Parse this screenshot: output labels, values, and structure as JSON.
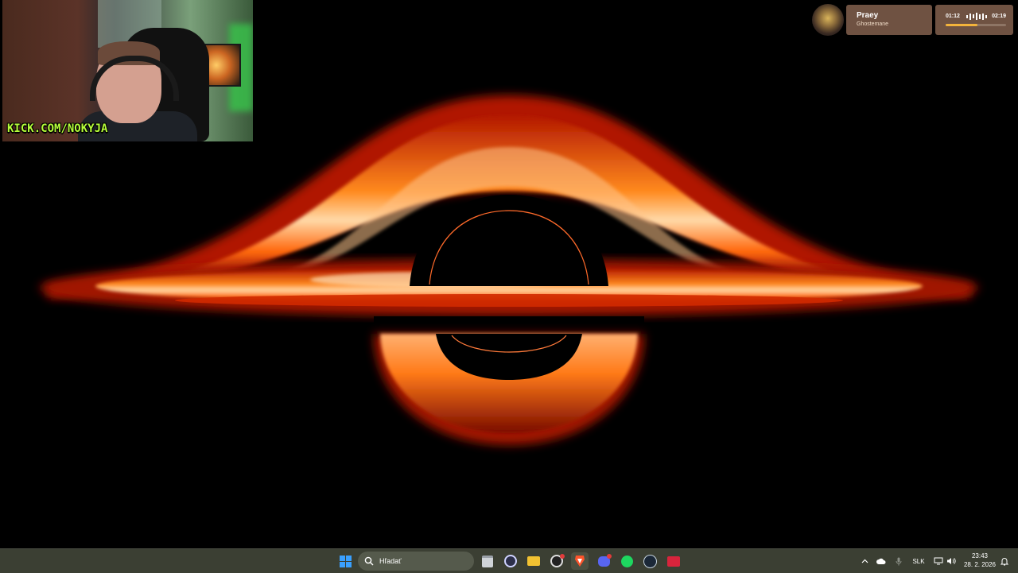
{
  "webcam": {
    "overlay_text": "KICK.COM/NOKYJA"
  },
  "now_playing": {
    "title": "Praey",
    "artist": "Ghostemane",
    "current_time": "01:12",
    "duration": "02:19",
    "progress": 0.52,
    "accent_color": "#f3b33b"
  },
  "taskbar": {
    "search_placeholder": "Hľadať",
    "apps": [
      "start-icon",
      "file-explorer-icon",
      "obs-icon",
      "folder-icon",
      "browser-icon",
      "brave-icon",
      "discord-icon",
      "spotify-icon",
      "steam-icon",
      "video-app-icon"
    ],
    "tray": {
      "language": "SLK",
      "time": "23:43",
      "date": "28. 2. 2026"
    }
  },
  "colors": {
    "taskbar": "#3b3f33",
    "disk_outer": "#b31800",
    "disk_inner": "#ffd9a8"
  }
}
